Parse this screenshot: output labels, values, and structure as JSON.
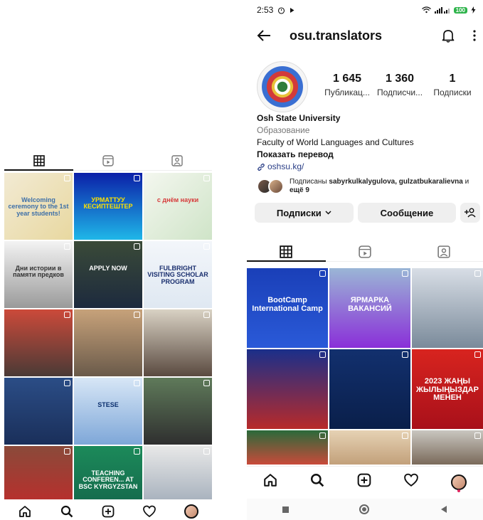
{
  "left_screen": {
    "posts": [
      {
        "caption": "Welcoming ceremony to the 1st year students!",
        "bg": "linear-gradient(135deg,#f2ead3,#e8d8a0)",
        "fg": "#3d6fa8"
      },
      {
        "caption": "УРМАТТУУ КЕСИПТЕШТЕР",
        "bg": "linear-gradient(180deg,#0b1fa8,#1fb7e8)",
        "fg": "#ffe100"
      },
      {
        "caption": "с днём науки",
        "bg": "linear-gradient(135deg,#f4f7ef,#cfe4c8)",
        "fg": "#d63a3a"
      },
      {
        "caption": "Дни истории в памяти предков",
        "bg": "linear-gradient(180deg,#f3f3f3,#9a9a9a)",
        "fg": "#333333"
      },
      {
        "caption": "APPLY NOW",
        "bg": "linear-gradient(180deg,#3a4a38,#1d2a3e)",
        "fg": "#ffffff"
      },
      {
        "caption": "FULBRIGHT VISITING SCHOLAR PROGRAM",
        "bg": "linear-gradient(180deg,#f3f6fa,#dfe8f2)",
        "fg": "#1a2f6e"
      },
      {
        "caption": "",
        "bg": "linear-gradient(180deg,#cc4a3a,#4a3a36)",
        "fg": "#ffffff"
      },
      {
        "caption": "",
        "bg": "linear-gradient(180deg,#c7a27a,#6a5a4a)",
        "fg": "#ffffff"
      },
      {
        "caption": "",
        "bg": "linear-gradient(180deg,#d9d2c4,#5a4a40)",
        "fg": "#ffffff"
      },
      {
        "caption": "",
        "bg": "linear-gradient(180deg,#2b4d86,#1a2f5a)",
        "fg": "#ffffff"
      },
      {
        "caption": "STESE",
        "bg": "linear-gradient(180deg,#d7e6f6,#7ea7d8)",
        "fg": "#0b2f6e"
      },
      {
        "caption": "",
        "bg": "linear-gradient(180deg,#5f7a5a,#2f2f2f)",
        "fg": "#ffffff"
      },
      {
        "caption": "",
        "bg": "linear-gradient(180deg,#8a4a3a,#c12a2a)",
        "fg": "#ffffff"
      },
      {
        "caption": "TEACHING CONFEREN... AT BSC KYRGYZSTAN",
        "bg": "linear-gradient(180deg,#1c8a5a,#13654a)",
        "fg": "#ffffff"
      },
      {
        "caption": "",
        "bg": "linear-gradient(180deg,#e8e8e8,#9aa6b4)",
        "fg": "#ffffff"
      }
    ]
  },
  "right_screen": {
    "status_time": "2:53",
    "battery": "100",
    "username": "osu.translators",
    "stats": [
      {
        "value": "1 645",
        "label": "Публикац..."
      },
      {
        "value": "1 360",
        "label": "Подписчи..."
      },
      {
        "value": "1",
        "label": "Подписки"
      }
    ],
    "bio": {
      "name": "Osh State University",
      "category": "Образование",
      "description": "Faculty of World Languages and Cultures",
      "translate": "Показать перевод",
      "link": "oshsu.kg/"
    },
    "followed_by": {
      "prefix": "Подписаны ",
      "names": "sabyrkulkalygulova, gulzatbukaralievna",
      "suffix": " и ",
      "more": "ещё 9"
    },
    "buttons": {
      "following": "Подписки",
      "message": "Сообщение"
    },
    "posts": [
      {
        "caption": "BootCamp International Camp",
        "bg": "linear-gradient(180deg,#1a3fb8,#2a5ad8)",
        "fg": "#ffffff"
      },
      {
        "caption": "ЯРМАРКА ВАКАНСИЙ",
        "bg": "linear-gradient(180deg,#9ab6d6,#8a2fd8)",
        "fg": "#ffffff"
      },
      {
        "caption": "",
        "bg": "linear-gradient(180deg,#d8dee6,#7a8a9a)",
        "fg": "#ffffff"
      },
      {
        "caption": "",
        "bg": "linear-gradient(180deg,#1a2f8a,#b82a2a)",
        "fg": "#ffffff"
      },
      {
        "caption": "",
        "bg": "linear-gradient(180deg,#12306e,#0a1f4a)",
        "fg": "#ffffff"
      },
      {
        "caption": "2023 ЖАҢЫ ЖЫЛЫҢЫЗДАР МЕНЕН",
        "bg": "linear-gradient(180deg,#d8241f,#a8101a)",
        "fg": "#ffffff"
      },
      {
        "caption": "",
        "bg": "linear-gradient(180deg,#2a6a3a,#c94a3a)",
        "fg": "#ffffff"
      },
      {
        "caption": "",
        "bg": "linear-gradient(180deg,#e6d2b4,#c2a07a)",
        "fg": "#ffffff"
      },
      {
        "caption": "",
        "bg": "linear-gradient(180deg,#c9c6c0,#7a6a5a)",
        "fg": "#ffffff"
      }
    ]
  }
}
